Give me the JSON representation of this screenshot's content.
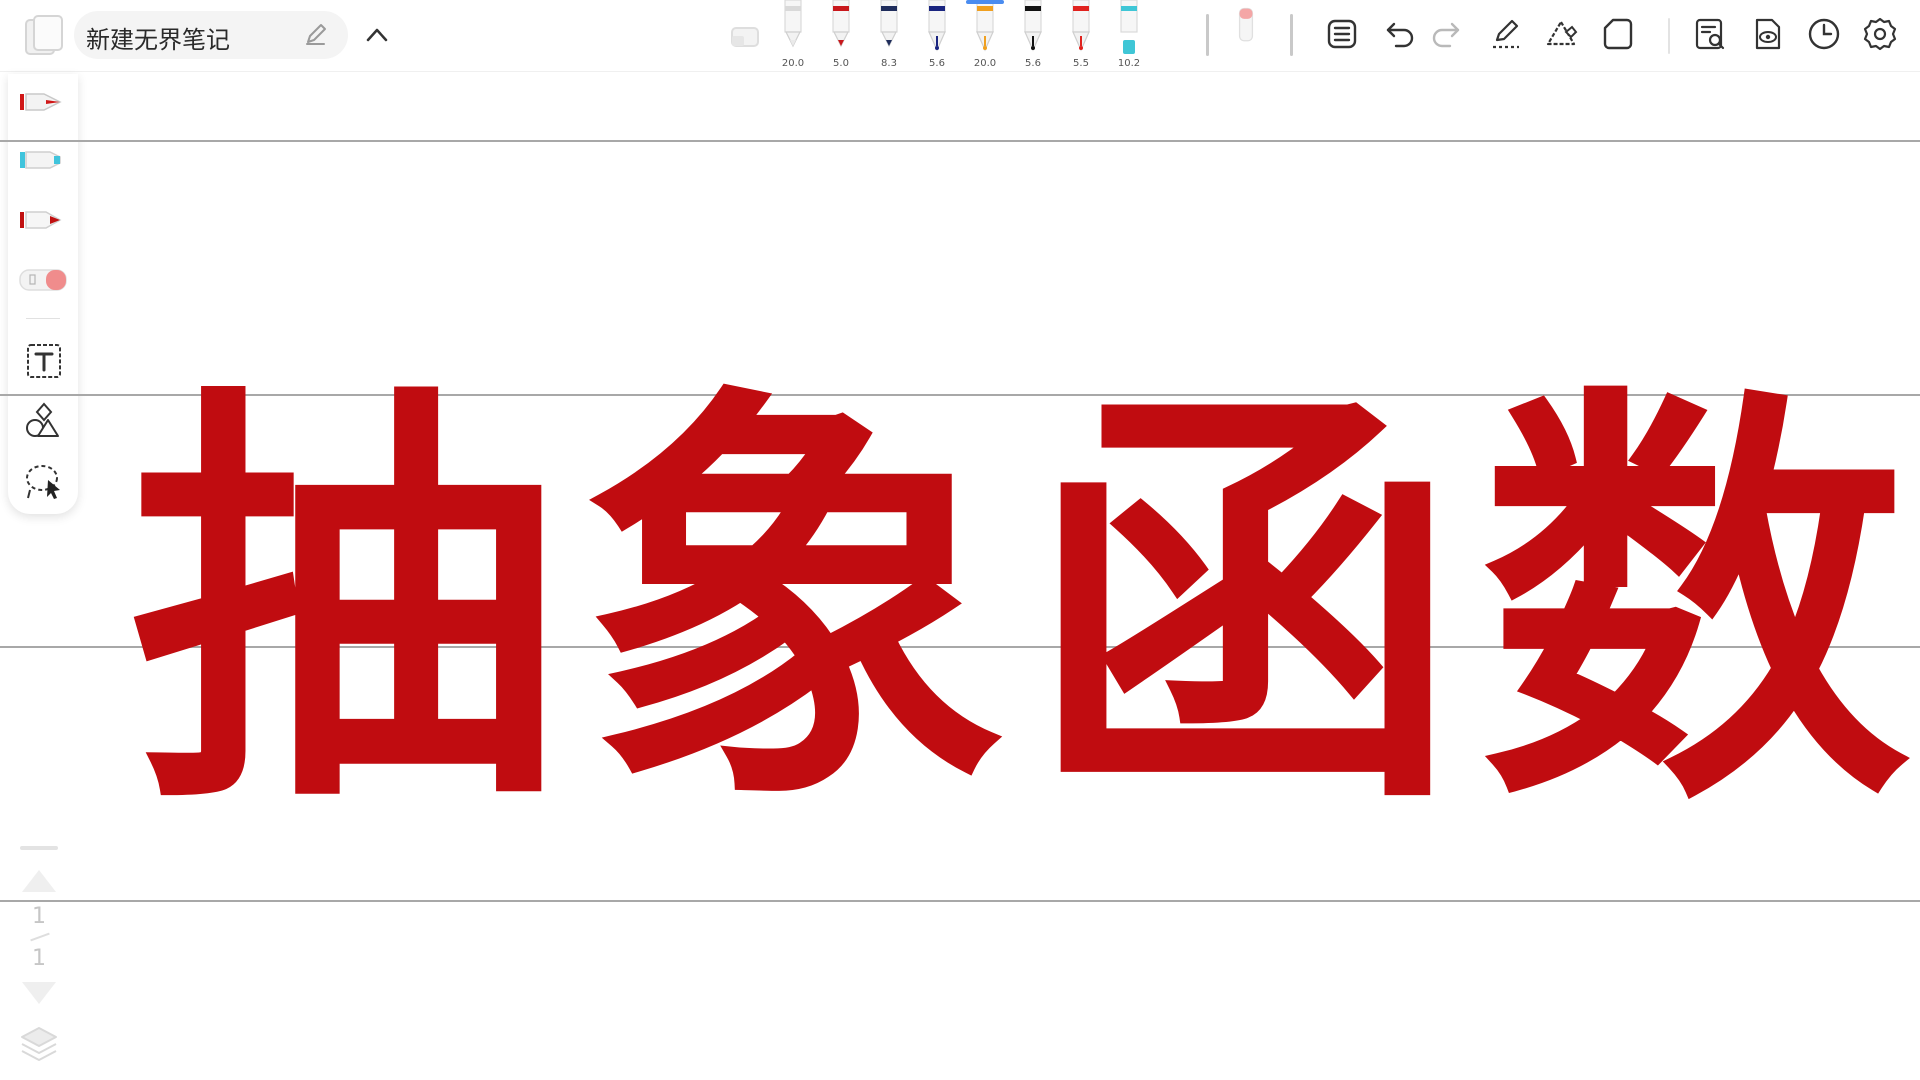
{
  "document": {
    "title": "新建无界笔记"
  },
  "pens": [
    {
      "name": "white-pen",
      "size": "20.0",
      "color": "#eaeaea"
    },
    {
      "name": "red-ballpoint",
      "size": "5.0",
      "color": "#c8181c"
    },
    {
      "name": "navy-ballpoint",
      "size": "8.3",
      "color": "#1f2d5c"
    },
    {
      "name": "navy-fountain-pen",
      "size": "5.6",
      "color": "#1a2580"
    },
    {
      "name": "orange-fountain-pen",
      "size": "20.0",
      "color": "#f0a020"
    },
    {
      "name": "black-fountain-pen",
      "size": "5.6",
      "color": "#111111"
    },
    {
      "name": "red-fountain-pen",
      "size": "5.5",
      "color": "#e0221e"
    },
    {
      "name": "cyan-marker",
      "size": "10.2",
      "color": "#3fc6d6"
    }
  ],
  "toolbar_icons": [
    "eraser-icon",
    "list-icon",
    "undo-icon",
    "redo-icon",
    "pen-settings-icon",
    "shape-recognize-icon",
    "page-icon",
    "search-note-icon",
    "preview-icon",
    "history-icon",
    "settings-icon"
  ],
  "canvas": {
    "heading": "抽象函数",
    "heading_color": "#c00c10"
  },
  "pagination": {
    "current": "1",
    "total": "1"
  }
}
